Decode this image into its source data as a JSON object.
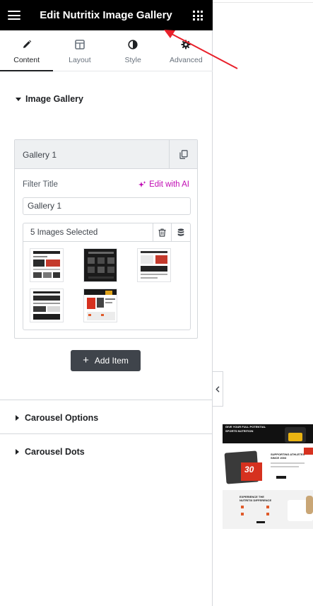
{
  "topbar": {
    "title": "Edit Nutritix Image Gallery",
    "menu_icon": "hamburger-icon",
    "apps_icon": "grid-apps-icon"
  },
  "tabs": [
    {
      "label": "Content",
      "icon": "pencil-icon",
      "active": true
    },
    {
      "label": "Layout",
      "icon": "layout-icon",
      "active": false
    },
    {
      "label": "Style",
      "icon": "half-circle-icon",
      "active": false
    },
    {
      "label": "Advanced",
      "icon": "gear-icon",
      "active": false
    }
  ],
  "image_gallery_section": {
    "title": "Image Gallery",
    "item": {
      "title": "Gallery 1",
      "filter_title_label": "Filter Title",
      "edit_ai_label": "Edit with AI",
      "filter_title_value": "Gallery 1",
      "images_selected": "5 Images Selected"
    },
    "add_item_label": "Add Item"
  },
  "sections": {
    "carousel_options": "Carousel Options",
    "carousel_dots": "Carousel Dots"
  },
  "preview": {
    "headline_top": "GIVE YOUR FULL POTENTIAL",
    "headline_sub": "SPORTS NUTRITION",
    "badge_number": "30",
    "support_line1": "SUPPORTING ATHLETES",
    "support_line2": "SINCE 2003",
    "experience_line1": "EXPERIENCE THE",
    "experience_line2": "NUTRITIX DIFFERENCE"
  },
  "colors": {
    "accent_ai": "#c00bb3",
    "annotation_arrow": "#e8202a",
    "topbar_bg": "#000000",
    "button_bg": "#3f444b"
  }
}
